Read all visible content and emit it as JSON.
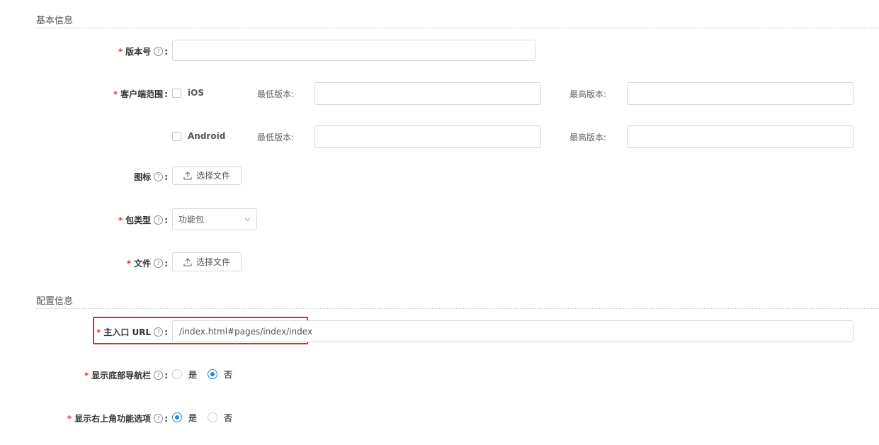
{
  "sections": {
    "basic": "基本信息",
    "config": "配置信息"
  },
  "fields": {
    "version": {
      "label": "版本号",
      "value": ""
    },
    "client_range": {
      "label": "客户端范围",
      "ios": {
        "label": "iOS",
        "checked": false,
        "min_label": "最低版本:",
        "max_label": "最高版本:",
        "min_value": "",
        "max_value": ""
      },
      "android": {
        "label": "Android",
        "checked": false,
        "min_label": "最低版本:",
        "max_label": "最高版本:",
        "min_value": "",
        "max_value": ""
      }
    },
    "icon": {
      "label": "图标",
      "button": "选择文件"
    },
    "package_type": {
      "label": "包类型",
      "value": "功能包"
    },
    "file": {
      "label": "文件",
      "button": "选择文件"
    },
    "main_url": {
      "label": "主入口 URL",
      "value": "/index.html#pages/index/index"
    },
    "bottom_nav": {
      "label": "显示底部导航栏",
      "options": [
        "是",
        "否"
      ],
      "selected": "否"
    },
    "top_right": {
      "label": "显示右上角功能选项",
      "options": [
        "是",
        "否"
      ],
      "selected": "是"
    }
  },
  "colors": {
    "required": "#e53935",
    "accent": "#1e88e5",
    "highlight": "#e0282e"
  },
  "icons": {
    "help": "question-circle-icon",
    "upload": "upload-icon",
    "chevron": "chevron-down-icon"
  }
}
